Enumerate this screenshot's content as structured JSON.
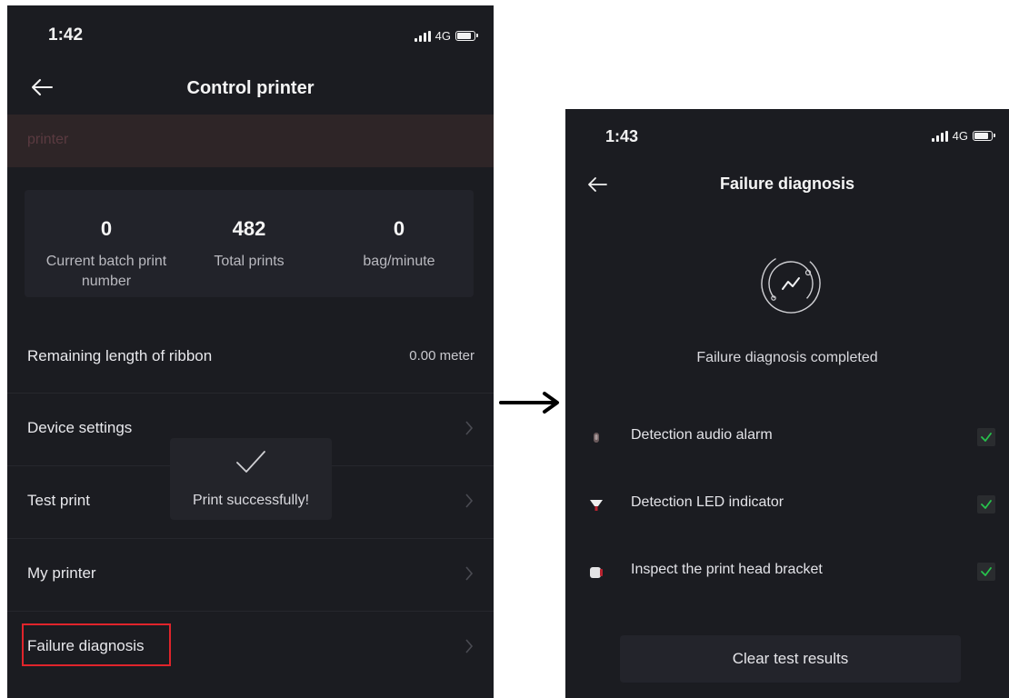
{
  "screen1": {
    "status": {
      "time": "1:42",
      "network": "4G"
    },
    "nav": {
      "title": "Control printer"
    },
    "printer_name": "printer",
    "stats": [
      {
        "value": "0",
        "label": "Current batch print number"
      },
      {
        "value": "482",
        "label": "Total prints"
      },
      {
        "value": "0",
        "label": "bag/minute"
      }
    ],
    "menu": {
      "ribbon_label": "Remaining length of ribbon",
      "ribbon_value": "0.00 meter",
      "device_settings": "Device settings",
      "test_print": "Test print",
      "my_printer": "My printer",
      "failure_diagnosis": "Failure diagnosis"
    },
    "toast": {
      "message": "Print successfully!"
    }
  },
  "screen2": {
    "status": {
      "time": "1:43",
      "network": "4G"
    },
    "nav": {
      "title": "Failure diagnosis"
    },
    "status_text": "Failure diagnosis completed",
    "checks": [
      {
        "label": "Detection audio alarm",
        "checked": true,
        "icon": "speaker-icon"
      },
      {
        "label": "Detection LED indicator",
        "checked": true,
        "icon": "led-icon"
      },
      {
        "label": "Inspect the print head bracket",
        "checked": true,
        "icon": "print-head-icon"
      }
    ],
    "clear_button": "Clear test results"
  },
  "colors": {
    "background": "#1b1c21",
    "card": "#22232a",
    "checkmark": "#27c24c",
    "highlight": "#e0242b",
    "printer_bar": "#2e2527"
  }
}
